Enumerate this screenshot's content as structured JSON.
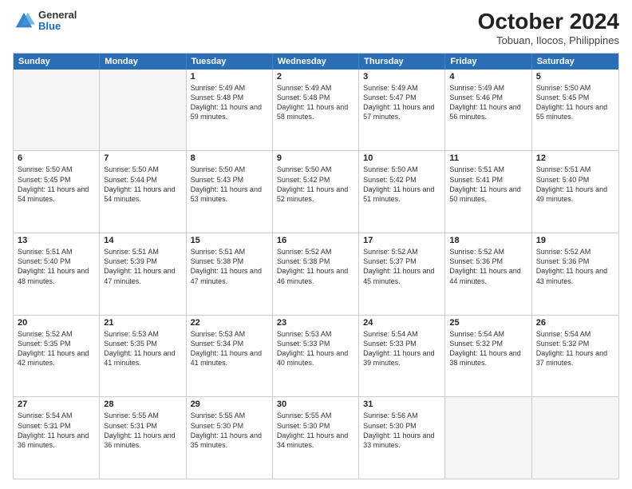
{
  "logo": {
    "general": "General",
    "blue": "Blue"
  },
  "title": "October 2024",
  "location": "Tobuan, Ilocos, Philippines",
  "days": [
    "Sunday",
    "Monday",
    "Tuesday",
    "Wednesday",
    "Thursday",
    "Friday",
    "Saturday"
  ],
  "weeks": [
    [
      {
        "num": "",
        "empty": true
      },
      {
        "num": "",
        "empty": true
      },
      {
        "num": "1",
        "sunrise": "Sunrise: 5:49 AM",
        "sunset": "Sunset: 5:48 PM",
        "daylight": "Daylight: 11 hours and 59 minutes."
      },
      {
        "num": "2",
        "sunrise": "Sunrise: 5:49 AM",
        "sunset": "Sunset: 5:48 PM",
        "daylight": "Daylight: 11 hours and 58 minutes."
      },
      {
        "num": "3",
        "sunrise": "Sunrise: 5:49 AM",
        "sunset": "Sunset: 5:47 PM",
        "daylight": "Daylight: 11 hours and 57 minutes."
      },
      {
        "num": "4",
        "sunrise": "Sunrise: 5:49 AM",
        "sunset": "Sunset: 5:46 PM",
        "daylight": "Daylight: 11 hours and 56 minutes."
      },
      {
        "num": "5",
        "sunrise": "Sunrise: 5:50 AM",
        "sunset": "Sunset: 5:45 PM",
        "daylight": "Daylight: 11 hours and 55 minutes."
      }
    ],
    [
      {
        "num": "6",
        "sunrise": "Sunrise: 5:50 AM",
        "sunset": "Sunset: 5:45 PM",
        "daylight": "Daylight: 11 hours and 54 minutes."
      },
      {
        "num": "7",
        "sunrise": "Sunrise: 5:50 AM",
        "sunset": "Sunset: 5:44 PM",
        "daylight": "Daylight: 11 hours and 54 minutes."
      },
      {
        "num": "8",
        "sunrise": "Sunrise: 5:50 AM",
        "sunset": "Sunset: 5:43 PM",
        "daylight": "Daylight: 11 hours and 53 minutes."
      },
      {
        "num": "9",
        "sunrise": "Sunrise: 5:50 AM",
        "sunset": "Sunset: 5:42 PM",
        "daylight": "Daylight: 11 hours and 52 minutes."
      },
      {
        "num": "10",
        "sunrise": "Sunrise: 5:50 AM",
        "sunset": "Sunset: 5:42 PM",
        "daylight": "Daylight: 11 hours and 51 minutes."
      },
      {
        "num": "11",
        "sunrise": "Sunrise: 5:51 AM",
        "sunset": "Sunset: 5:41 PM",
        "daylight": "Daylight: 11 hours and 50 minutes."
      },
      {
        "num": "12",
        "sunrise": "Sunrise: 5:51 AM",
        "sunset": "Sunset: 5:40 PM",
        "daylight": "Daylight: 11 hours and 49 minutes."
      }
    ],
    [
      {
        "num": "13",
        "sunrise": "Sunrise: 5:51 AM",
        "sunset": "Sunset: 5:40 PM",
        "daylight": "Daylight: 11 hours and 48 minutes."
      },
      {
        "num": "14",
        "sunrise": "Sunrise: 5:51 AM",
        "sunset": "Sunset: 5:39 PM",
        "daylight": "Daylight: 11 hours and 47 minutes."
      },
      {
        "num": "15",
        "sunrise": "Sunrise: 5:51 AM",
        "sunset": "Sunset: 5:38 PM",
        "daylight": "Daylight: 11 hours and 47 minutes."
      },
      {
        "num": "16",
        "sunrise": "Sunrise: 5:52 AM",
        "sunset": "Sunset: 5:38 PM",
        "daylight": "Daylight: 11 hours and 46 minutes."
      },
      {
        "num": "17",
        "sunrise": "Sunrise: 5:52 AM",
        "sunset": "Sunset: 5:37 PM",
        "daylight": "Daylight: 11 hours and 45 minutes."
      },
      {
        "num": "18",
        "sunrise": "Sunrise: 5:52 AM",
        "sunset": "Sunset: 5:36 PM",
        "daylight": "Daylight: 11 hours and 44 minutes."
      },
      {
        "num": "19",
        "sunrise": "Sunrise: 5:52 AM",
        "sunset": "Sunset: 5:36 PM",
        "daylight": "Daylight: 11 hours and 43 minutes."
      }
    ],
    [
      {
        "num": "20",
        "sunrise": "Sunrise: 5:52 AM",
        "sunset": "Sunset: 5:35 PM",
        "daylight": "Daylight: 11 hours and 42 minutes."
      },
      {
        "num": "21",
        "sunrise": "Sunrise: 5:53 AM",
        "sunset": "Sunset: 5:35 PM",
        "daylight": "Daylight: 11 hours and 41 minutes."
      },
      {
        "num": "22",
        "sunrise": "Sunrise: 5:53 AM",
        "sunset": "Sunset: 5:34 PM",
        "daylight": "Daylight: 11 hours and 41 minutes."
      },
      {
        "num": "23",
        "sunrise": "Sunrise: 5:53 AM",
        "sunset": "Sunset: 5:33 PM",
        "daylight": "Daylight: 11 hours and 40 minutes."
      },
      {
        "num": "24",
        "sunrise": "Sunrise: 5:54 AM",
        "sunset": "Sunset: 5:33 PM",
        "daylight": "Daylight: 11 hours and 39 minutes."
      },
      {
        "num": "25",
        "sunrise": "Sunrise: 5:54 AM",
        "sunset": "Sunset: 5:32 PM",
        "daylight": "Daylight: 11 hours and 38 minutes."
      },
      {
        "num": "26",
        "sunrise": "Sunrise: 5:54 AM",
        "sunset": "Sunset: 5:32 PM",
        "daylight": "Daylight: 11 hours and 37 minutes."
      }
    ],
    [
      {
        "num": "27",
        "sunrise": "Sunrise: 5:54 AM",
        "sunset": "Sunset: 5:31 PM",
        "daylight": "Daylight: 11 hours and 36 minutes."
      },
      {
        "num": "28",
        "sunrise": "Sunrise: 5:55 AM",
        "sunset": "Sunset: 5:31 PM",
        "daylight": "Daylight: 11 hours and 36 minutes."
      },
      {
        "num": "29",
        "sunrise": "Sunrise: 5:55 AM",
        "sunset": "Sunset: 5:30 PM",
        "daylight": "Daylight: 11 hours and 35 minutes."
      },
      {
        "num": "30",
        "sunrise": "Sunrise: 5:55 AM",
        "sunset": "Sunset: 5:30 PM",
        "daylight": "Daylight: 11 hours and 34 minutes."
      },
      {
        "num": "31",
        "sunrise": "Sunrise: 5:56 AM",
        "sunset": "Sunset: 5:30 PM",
        "daylight": "Daylight: 11 hours and 33 minutes."
      },
      {
        "num": "",
        "empty": true
      },
      {
        "num": "",
        "empty": true
      }
    ]
  ]
}
